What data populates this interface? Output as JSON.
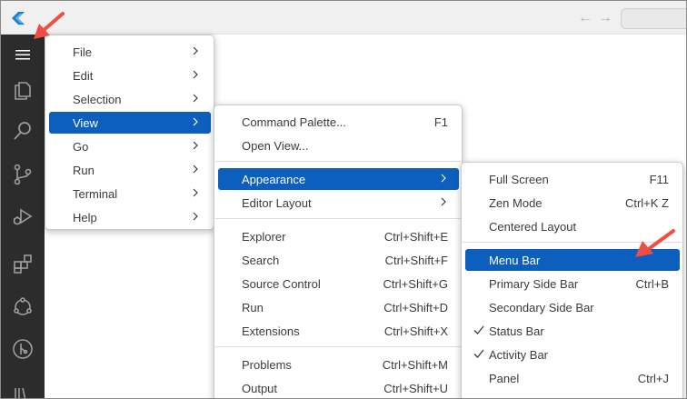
{
  "colors": {
    "accent": "#0c5fbd",
    "activity_bar": "#2c2c2c",
    "arrow": "#f04e45"
  },
  "titlebar": {
    "logo_icon": "vscode-logo-icon",
    "back_icon": "arrow-left-icon",
    "forward_icon": "arrow-right-icon",
    "back_glyph": "←",
    "forward_glyph": "→"
  },
  "activity_bar": {
    "items": [
      "menu-hamburger-icon",
      "explorer-icon",
      "search-icon",
      "source-control-icon",
      "run-debug-icon",
      "extensions-icon",
      "remote-icon",
      "git-graph-icon",
      "library-icon"
    ]
  },
  "main_menu": {
    "items": [
      {
        "label": "File"
      },
      {
        "label": "Edit"
      },
      {
        "label": "Selection"
      },
      {
        "label": "View",
        "highlighted": true
      },
      {
        "label": "Go"
      },
      {
        "label": "Run"
      },
      {
        "label": "Terminal"
      },
      {
        "label": "Help"
      }
    ]
  },
  "view_menu": {
    "items": [
      {
        "label": "Command Palette...",
        "shortcut": "F1"
      },
      {
        "label": "Open View..."
      },
      {
        "label": "Appearance",
        "highlighted": true,
        "submenu": true
      },
      {
        "label": "Editor Layout",
        "submenu": true
      },
      {
        "label": "Explorer",
        "shortcut": "Ctrl+Shift+E"
      },
      {
        "label": "Search",
        "shortcut": "Ctrl+Shift+F"
      },
      {
        "label": "Source Control",
        "shortcut": "Ctrl+Shift+G"
      },
      {
        "label": "Run",
        "shortcut": "Ctrl+Shift+D"
      },
      {
        "label": "Extensions",
        "shortcut": "Ctrl+Shift+X"
      },
      {
        "label": "Problems",
        "shortcut": "Ctrl+Shift+M"
      },
      {
        "label": "Output",
        "shortcut": "Ctrl+Shift+U"
      }
    ]
  },
  "appearance_menu": {
    "items": [
      {
        "label": "Full Screen",
        "shortcut": "F11"
      },
      {
        "label": "Zen Mode",
        "shortcut": "Ctrl+K Z"
      },
      {
        "label": "Centered Layout"
      },
      {
        "label": "Menu Bar",
        "highlighted": true
      },
      {
        "label": "Primary Side Bar",
        "shortcut": "Ctrl+B"
      },
      {
        "label": "Secondary Side Bar"
      },
      {
        "label": "Status Bar",
        "checked": true
      },
      {
        "label": "Activity Bar",
        "checked": true
      },
      {
        "label": "Panel",
        "shortcut": "Ctrl+J"
      }
    ]
  }
}
